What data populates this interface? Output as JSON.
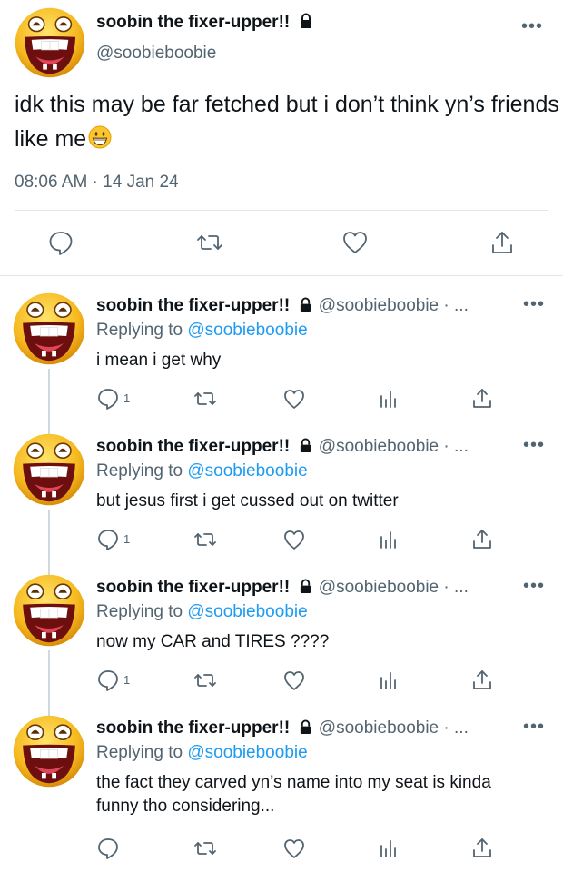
{
  "main_tweet": {
    "display_name": "soobin the fixer-upper!!",
    "handle": "@soobieboobie",
    "more": "•••",
    "text": "idk this may be far fetched but i don’t think yn’s friends like me",
    "timestamp": "08:06 AM · 14 Jan 24",
    "actions": [
      "reply-icon",
      "retweet-icon",
      "like-icon",
      "share-icon"
    ]
  },
  "replies": [
    {
      "display_name": "soobin the fixer-upper!!",
      "handle": "@soobieboobie · ...",
      "replying_label": "Replying to",
      "replying_to": "@soobieboobie",
      "text": "i mean i get why",
      "reply_count": "1"
    },
    {
      "display_name": "soobin the fixer-upper!!",
      "handle": "@soobieboobie · ...",
      "replying_label": "Replying to",
      "replying_to": "@soobieboobie",
      "text": "but jesus first i get cussed out on twitter",
      "reply_count": "1"
    },
    {
      "display_name": "soobin the fixer-upper!!",
      "handle": "@soobieboobie · ...",
      "replying_label": "Replying to",
      "replying_to": "@soobieboobie",
      "text": "now my CAR and TIRES ????",
      "reply_count": "1"
    },
    {
      "display_name": "soobin the fixer-upper!!",
      "handle": "@soobieboobie · ...",
      "replying_label": "Replying to",
      "replying_to": "@soobieboobie",
      "text": "the fact they carved yn’s name into my seat is kinda funny tho considering...",
      "reply_count": ""
    }
  ],
  "colors": {
    "link": "#1d9bf0",
    "muted": "#536471",
    "text": "#0f1419"
  }
}
